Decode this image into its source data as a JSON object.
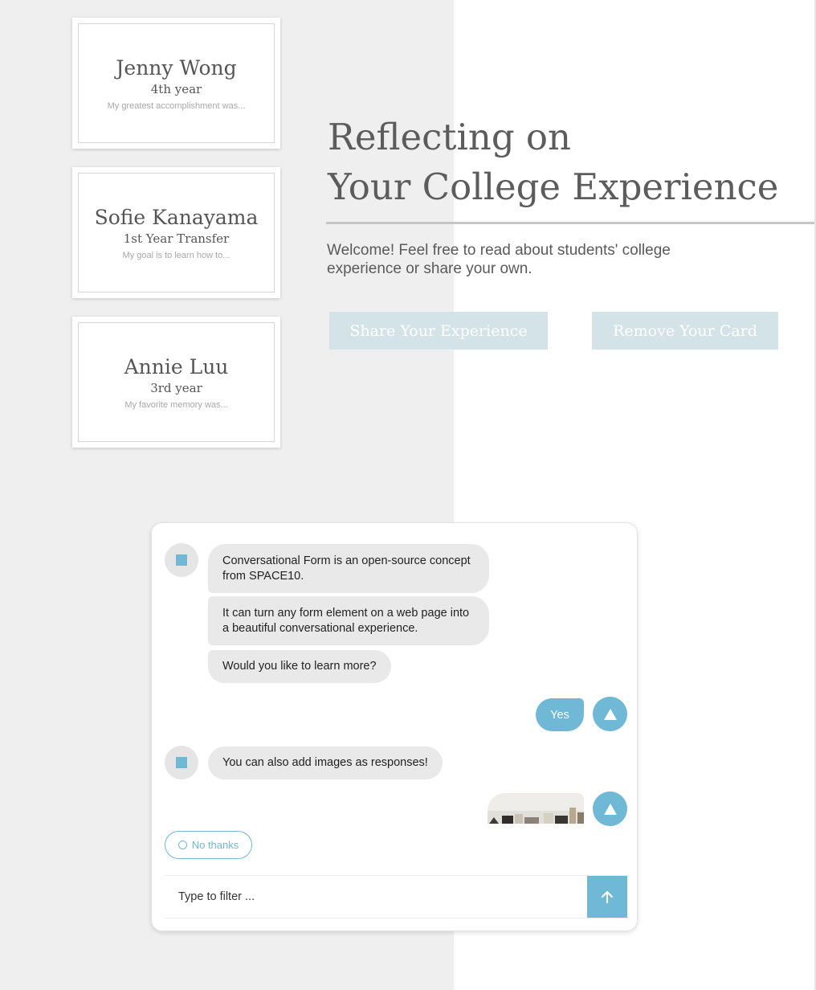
{
  "cards": [
    {
      "name": "Jenny Wong",
      "year": "4th year",
      "snippet": "My greatest accomplishment was..."
    },
    {
      "name": "Sofie Kanayama",
      "year": "1st Year Transfer",
      "snippet": "My goal is to learn how to..."
    },
    {
      "name": "Annie Luu",
      "year": "3rd year",
      "snippet": "My favorite memory was..."
    }
  ],
  "hero": {
    "title_line1": "Reflecting on",
    "title_line2": "Your College Experience",
    "welcome": "Welcome! Feel free to read about students' college experience or share your own.",
    "share_button": "Share Your Experience",
    "remove_button": "Remove Your Card"
  },
  "chat": {
    "messages": [
      "Conversational Form is an open-source concept from SPACE10.",
      "It can turn any form element on a web page into a beautiful conversational experience.",
      "Would you like to learn more?",
      "You can also add images as responses!"
    ],
    "user_reply": "Yes",
    "option_no_thanks": "No thanks",
    "input_placeholder": "Type to filter ...",
    "icons": {
      "bot_avatar": "square-icon",
      "user_avatar": "triangle-up-icon",
      "send": "arrow-up-icon",
      "option": "circle-icon"
    }
  },
  "colors": {
    "accent": "#6fb8d6",
    "button_bg": "#d4e3e8",
    "left_panel": "#efefef",
    "text": "#5c5c5c"
  }
}
